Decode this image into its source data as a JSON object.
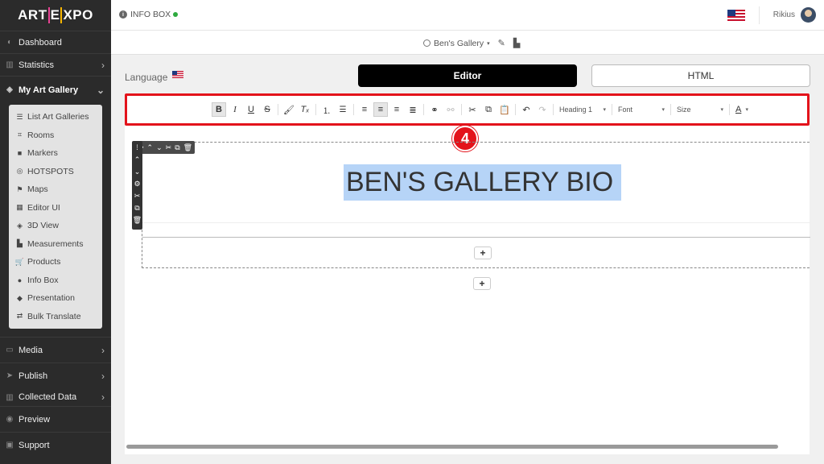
{
  "brand": {
    "logo_left": "ART",
    "logo_mid": "E",
    "logo_right": "XPO"
  },
  "topbar": {
    "section_title": "INFO BOX",
    "user_name": "Rikius"
  },
  "gallery": {
    "name": "Ben's Gallery"
  },
  "sidebar": {
    "items": [
      {
        "label": "Dashboard",
        "icon": "dashboard-icon"
      },
      {
        "label": "Statistics",
        "icon": "chart-icon"
      },
      {
        "label": "My Art Gallery",
        "icon": "gallery-icon"
      }
    ],
    "submenu": [
      {
        "label": "List Art Galleries",
        "glyph": "☰"
      },
      {
        "label": "Rooms",
        "glyph": "⌗"
      },
      {
        "label": "Markers",
        "glyph": "■"
      },
      {
        "label": "HOTSPOTS",
        "glyph": "◎"
      },
      {
        "label": "Maps",
        "glyph": "⚑"
      },
      {
        "label": "Editor UI",
        "glyph": "▦"
      },
      {
        "label": "3D View",
        "glyph": "◈"
      },
      {
        "label": "Measurements",
        "glyph": "▙"
      },
      {
        "label": "Products",
        "glyph": "🛒"
      },
      {
        "label": "Info Box",
        "glyph": "●"
      },
      {
        "label": "Presentation",
        "glyph": "◆"
      },
      {
        "label": "Bulk Translate",
        "glyph": "⇄"
      }
    ],
    "bottom_items": [
      {
        "label": "Media"
      },
      {
        "label": "Publish"
      },
      {
        "label": "Collected Data"
      },
      {
        "label": "Preview"
      },
      {
        "label": "Support"
      }
    ]
  },
  "main": {
    "language_label": "Language",
    "tab_editor": "Editor",
    "tab_html": "HTML",
    "step_number": "4",
    "heading_text": "BEN'S GALLERY BIO"
  },
  "toolbar": {
    "heading_select": "Heading 1",
    "font_select": "Font",
    "size_select": "Size",
    "text_color": "A"
  },
  "colors": {
    "sidebar_bg": "#2b2b2b",
    "highlight_red": "#e3131b",
    "selection_blue": "#b6d4f7",
    "status_green": "#2eaa3f"
  }
}
